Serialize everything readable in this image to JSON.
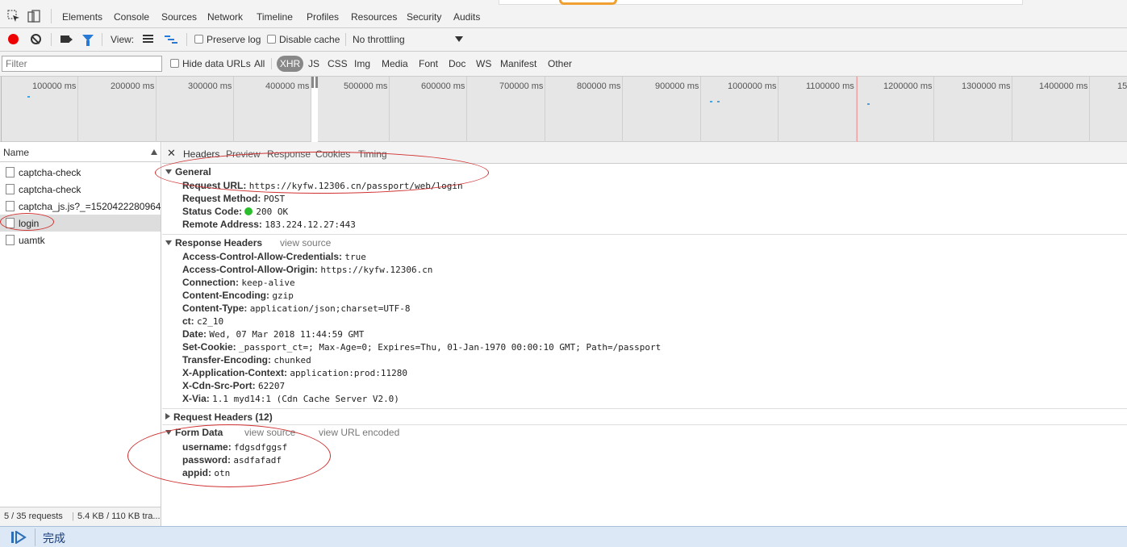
{
  "tabbar": {
    "tabs": [
      "Elements",
      "Console",
      "Sources",
      "Network",
      "Timeline",
      "Profiles",
      "Resources",
      "Security",
      "Audits"
    ],
    "active_tab": "Network"
  },
  "toolbar1": {
    "view_label": "View:",
    "preserve_log": "Preserve log",
    "disable_cache": "Disable cache",
    "throttling": "No throttling"
  },
  "toolbar2": {
    "filter_placeholder": "Filter",
    "hide_data_urls": "Hide data URLs",
    "types": [
      "All",
      "XHR",
      "JS",
      "CSS",
      "Img",
      "Media",
      "Font",
      "Doc",
      "WS",
      "Manifest",
      "Other"
    ],
    "active_type": "XHR"
  },
  "overview": {
    "ticks": [
      "100000 ms",
      "200000 ms",
      "300000 ms",
      "400000 ms",
      "500000 ms",
      "600000 ms",
      "700000 ms",
      "800000 ms",
      "900000 ms",
      "1000000 ms",
      "1100000 ms",
      "1200000 ms",
      "1300000 ms",
      "1400000 ms",
      "15"
    ]
  },
  "requests": {
    "header": "Name",
    "items": [
      {
        "name": "captcha-check"
      },
      {
        "name": "captcha-check"
      },
      {
        "name": "captcha_js.js?_=1520422280964"
      },
      {
        "name": "login"
      },
      {
        "name": "uamtk"
      }
    ],
    "selected_index": 3,
    "footer_count": "5 / 35 requests",
    "footer_size": "5.4 KB / 110 KB tra..."
  },
  "details": {
    "tabs": [
      "Headers",
      "Preview",
      "Response",
      "Cookies",
      "Timing"
    ],
    "active_tab": "Headers",
    "general": {
      "title": "General",
      "rows": [
        {
          "k": "Request URL:",
          "v": "https://kyfw.12306.cn/passport/web/login"
        },
        {
          "k": "Request Method:",
          "v": "POST"
        },
        {
          "k": "Status Code:",
          "v": "200 OK"
        },
        {
          "k": "Remote Address:",
          "v": "183.224.12.27:443"
        }
      ]
    },
    "response_headers": {
      "title": "Response Headers",
      "link": "view source",
      "rows": [
        {
          "k": "Access-Control-Allow-Credentials:",
          "v": "true"
        },
        {
          "k": "Access-Control-Allow-Origin:",
          "v": "https://kyfw.12306.cn"
        },
        {
          "k": "Connection:",
          "v": "keep-alive"
        },
        {
          "k": "Content-Encoding:",
          "v": "gzip"
        },
        {
          "k": "Content-Type:",
          "v": "application/json;charset=UTF-8"
        },
        {
          "k": "ct:",
          "v": "c2_10"
        },
        {
          "k": "Date:",
          "v": "Wed, 07 Mar 2018 11:44:59 GMT"
        },
        {
          "k": "Set-Cookie:",
          "v": "_passport_ct=; Max-Age=0; Expires=Thu, 01-Jan-1970 00:00:10 GMT; Path=/passport"
        },
        {
          "k": "Transfer-Encoding:",
          "v": "chunked"
        },
        {
          "k": "X-Application-Context:",
          "v": "application:prod:11280"
        },
        {
          "k": "X-Cdn-Src-Port:",
          "v": "62207"
        },
        {
          "k": "X-Via:",
          "v": "1.1 myd14:1 (Cdn Cache Server V2.0)"
        }
      ]
    },
    "request_headers": {
      "title": "Request Headers (12)"
    },
    "form_data": {
      "title": "Form Data",
      "link_source": "view source",
      "link_encoded": "view URL encoded",
      "rows": [
        {
          "k": "username:",
          "v": "fdgsdfggsf"
        },
        {
          "k": "password:",
          "v": "asdfafadf"
        },
        {
          "k": "appid:",
          "v": "otn"
        }
      ]
    }
  },
  "statusbar": {
    "text": "完成"
  },
  "colors": {
    "record": "#e00000",
    "accent": "#2979d6",
    "annotation": "#d03030",
    "status_ok": "#2bbd2b"
  }
}
